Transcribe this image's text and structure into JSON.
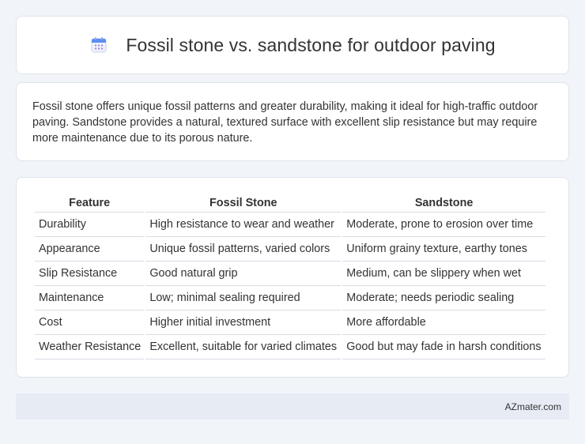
{
  "header": {
    "icon": "calendar-icon",
    "title": "Fossil stone vs. sandstone for outdoor paving"
  },
  "summary": {
    "text": "Fossil stone offers unique fossil patterns and greater durability, making it ideal for high-traffic outdoor paving. Sandstone provides a natural, textured surface with excellent slip resistance but may require more maintenance due to its porous nature."
  },
  "table": {
    "headers": [
      "Feature",
      "Fossil Stone",
      "Sandstone"
    ],
    "rows": [
      [
        "Durability",
        "High resistance to wear and weather",
        "Moderate, prone to erosion over time"
      ],
      [
        "Appearance",
        "Unique fossil patterns, varied colors",
        "Uniform grainy texture, earthy tones"
      ],
      [
        "Slip Resistance",
        "Good natural grip",
        "Medium, can be slippery when wet"
      ],
      [
        "Maintenance",
        "Low; minimal sealing required",
        "Moderate; needs periodic sealing"
      ],
      [
        "Cost",
        "Higher initial investment",
        "More affordable"
      ],
      [
        "Weather Resistance",
        "Excellent, suitable for varied climates",
        "Good but may fade in harsh conditions"
      ]
    ]
  },
  "footer": {
    "site": "AZmater.com"
  },
  "colors": {
    "background": "#f1f4f9",
    "card": "#ffffff",
    "footer_bar": "#e6ebf4",
    "icon_accent": "#5b8def",
    "icon_dots": "#9b7fe0"
  }
}
